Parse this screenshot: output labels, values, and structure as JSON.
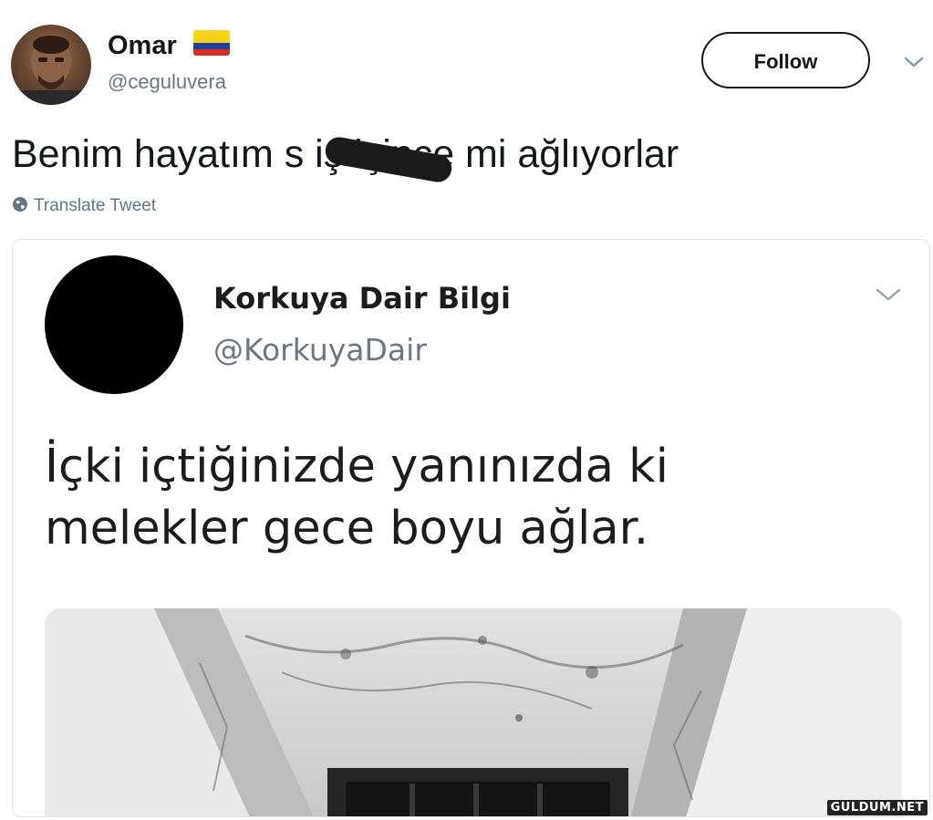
{
  "tweet": {
    "author": {
      "display_name": "Omar",
      "handle": "@ceguluvera",
      "flag_icon": "colombia-flag-icon"
    },
    "follow_label": "Follow",
    "text": "Benim hayatım s    iş içince mi ağlıyorlar",
    "translate_label": "Translate Tweet"
  },
  "quoted": {
    "author": {
      "display_name": "Korkuya Dair Bilgi",
      "handle": "@KorkuyaDair"
    },
    "text_line1": "İçki içtiğinizde yanınızda ki",
    "text_line2": "melekler gece boyu ağlar."
  },
  "watermark": "GULDUM.NET",
  "colors": {
    "text": "#14171a",
    "muted": "#657786",
    "border": "#dfe3e8"
  }
}
